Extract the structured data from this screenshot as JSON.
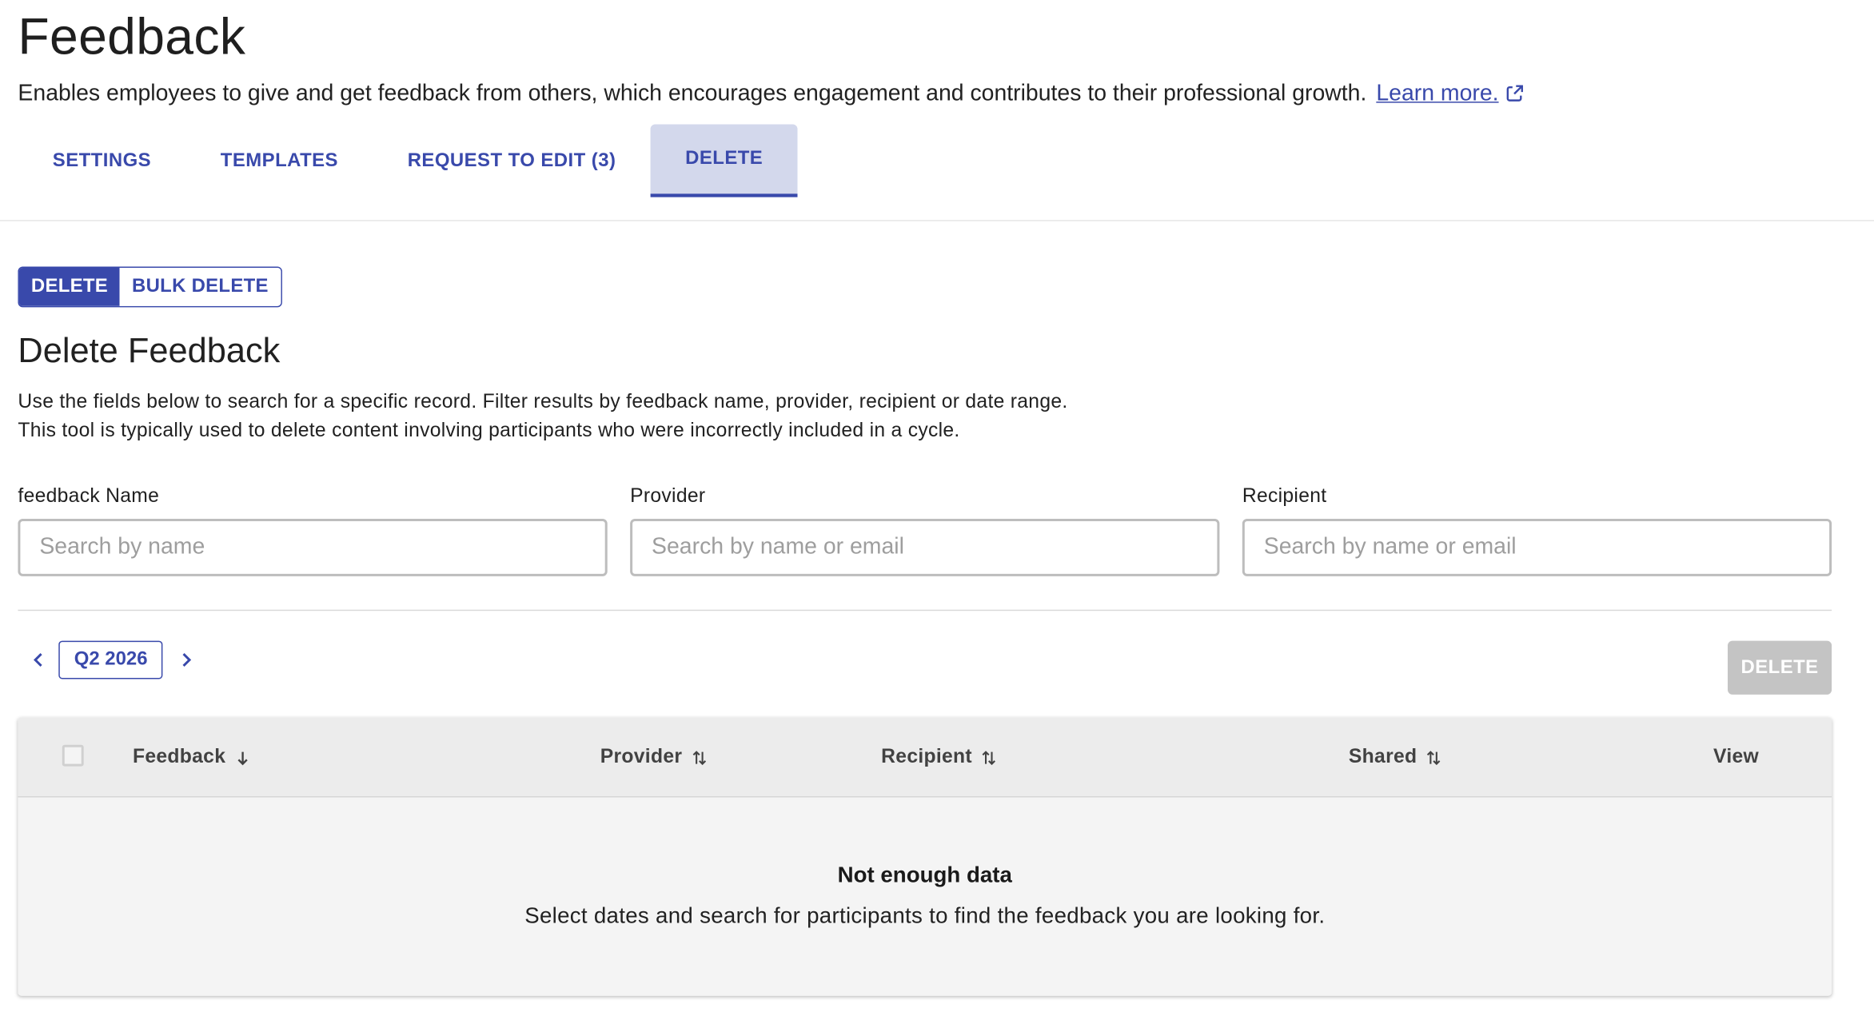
{
  "page": {
    "title": "Feedback",
    "description": "Enables employees to give and get feedback from others, which encourages engagement and contributes to their professional growth.",
    "learn_more": "Learn more."
  },
  "tabs": [
    {
      "label": "SETTINGS",
      "active": false
    },
    {
      "label": "TEMPLATES",
      "active": false
    },
    {
      "label": "REQUEST TO EDIT (3)",
      "active": false
    },
    {
      "label": "DELETE",
      "active": true
    }
  ],
  "mode_toggle": {
    "delete_label": "DELETE",
    "bulk_delete_label": "BULK DELETE",
    "selected": "DELETE"
  },
  "section": {
    "title": "Delete Feedback",
    "desc_line1": "Use the fields below to search for a specific record. Filter results by feedback name, provider, recipient or date range.",
    "desc_line2": "This tool is typically used to delete content involving participants who were incorrectly included in a cycle."
  },
  "filters": {
    "name": {
      "label": "feedback Name",
      "value": "",
      "placeholder": "Search by name"
    },
    "provider": {
      "label": "Provider",
      "value": "",
      "placeholder": "Search by name or email"
    },
    "recipient": {
      "label": "Recipient",
      "value": "",
      "placeholder": "Search by name or email"
    }
  },
  "period": {
    "label": "Q2 2026",
    "prev_icon": "chevron-left-icon",
    "next_icon": "chevron-right-icon"
  },
  "delete_button": {
    "label": "DELETE",
    "disabled": true
  },
  "table": {
    "columns": [
      {
        "label": "Feedback",
        "sort": "descending"
      },
      {
        "label": "Provider",
        "sort": "unsorted"
      },
      {
        "label": "Recipient",
        "sort": "unsorted"
      },
      {
        "label": "Shared",
        "sort": "unsorted"
      },
      {
        "label": "View",
        "sort": "none"
      }
    ],
    "rows": [],
    "empty_title": "Not enough data",
    "empty_desc": "Select dates and search for participants to find the feedback you are looking for."
  },
  "colors": {
    "accent": "#3949ab",
    "active_tab_bg": "#d3d8ec",
    "disabled_button": "#c4c4c4",
    "table_header_bg": "#ececec",
    "table_body_bg": "#f4f4f4"
  }
}
